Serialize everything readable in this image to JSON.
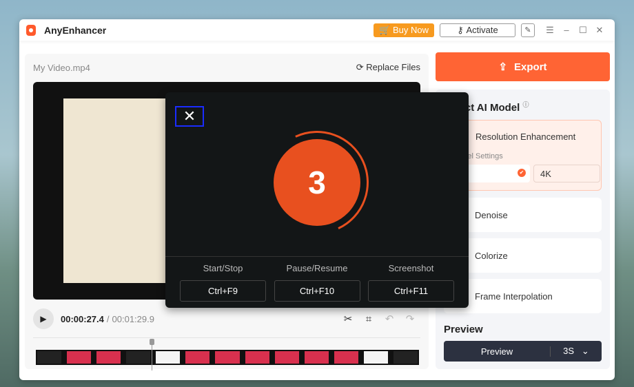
{
  "app": {
    "title": "AnyEnhancer",
    "buy_now": "Buy Now",
    "activate": "Activate"
  },
  "editor": {
    "file_name": "My Video.mp4",
    "replace_files": "Replace Files",
    "current_time": "00:00:27.4",
    "separator": "/",
    "total_time": "00:01:29.9"
  },
  "export": {
    "label": "Export"
  },
  "models": {
    "title": "Select AI Model",
    "items": [
      {
        "label": "Resolution Enhancement",
        "settings_label": "Model Settings",
        "resolution": "4K"
      },
      {
        "label": "Denoise"
      },
      {
        "label": "Colorize"
      },
      {
        "label": "Frame Interpolation"
      }
    ]
  },
  "preview": {
    "title": "Preview",
    "button": "Preview",
    "duration": "3S"
  },
  "overlay": {
    "countdown": "3",
    "shortcuts": [
      {
        "label": "Start/Stop",
        "key": "Ctrl+F9"
      },
      {
        "label": "Pause/Resume",
        "key": "Ctrl+F10"
      },
      {
        "label": "Screenshot",
        "key": "Ctrl+F11"
      }
    ]
  },
  "colors": {
    "accent": "#ff6434",
    "buy": "#f79a1f",
    "overlay_bg": "#131617"
  }
}
